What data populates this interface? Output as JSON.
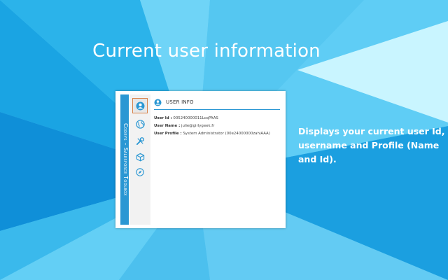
{
  "headline": "Current user information",
  "description": "Displays your current user Id, username and Profile (Name and Id).",
  "extension": {
    "side_tab_label": "Codeys – Salesforce Toolbox",
    "icons": [
      "user-icon",
      "globe-icon",
      "tools-icon",
      "cube-icon",
      "compass-icon"
    ],
    "active_icon": "user-icon"
  },
  "user_info": {
    "title": "USER INFO",
    "fields": [
      {
        "label": "User Id :",
        "value": "005240000011LcqPAAS"
      },
      {
        "label": "User Name :",
        "value": "julie@girlygeek.fr"
      },
      {
        "label": "User Profile :",
        "value": "System Administrator (00e24000000zahiAAA)"
      }
    ]
  },
  "colors": {
    "accent": "#2a97d3",
    "active_border": "#d9834a",
    "background_base": "#5ecdf5"
  }
}
